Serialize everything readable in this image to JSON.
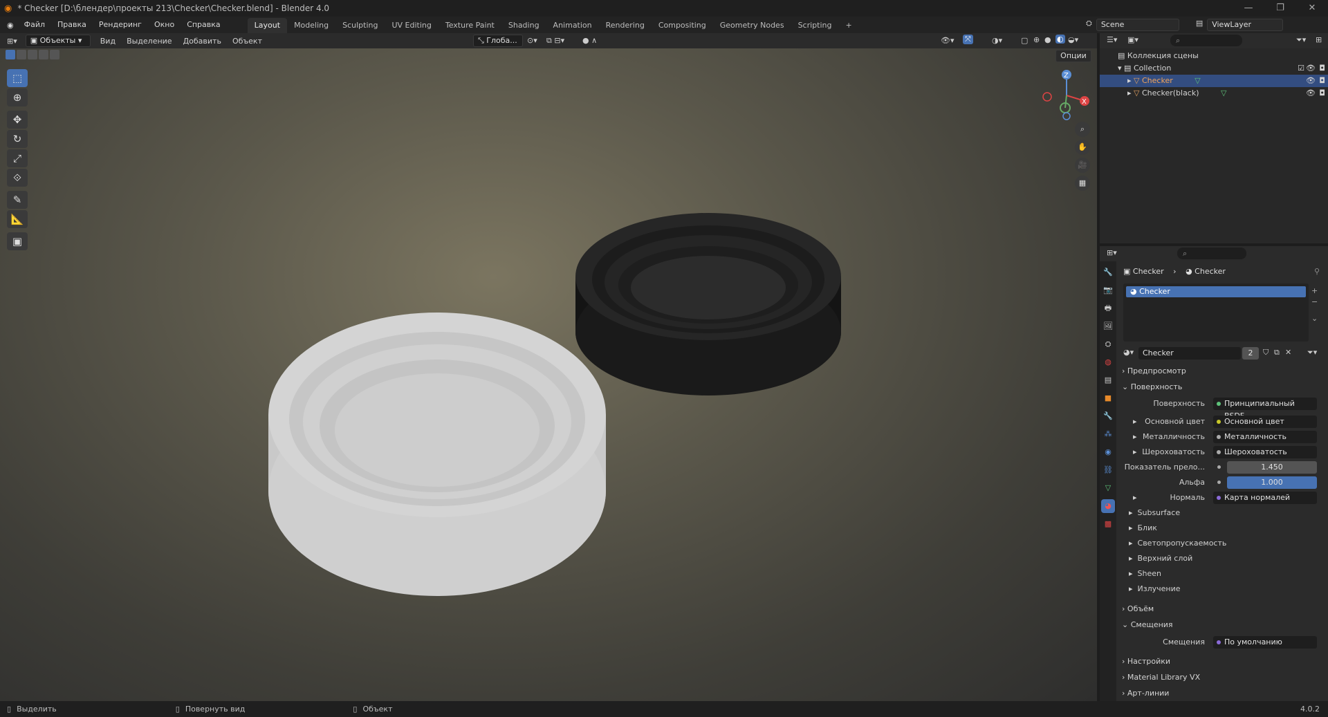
{
  "titlebar": {
    "title": "* Checker [D:\\блендер\\проекты 213\\Checker\\Checker.blend] - Blender 4.0"
  },
  "menu": [
    "Файл",
    "Правка",
    "Рендеринг",
    "Окно",
    "Справка"
  ],
  "workspaces": [
    "Layout",
    "Modeling",
    "Sculpting",
    "UV Editing",
    "Texture Paint",
    "Shading",
    "Animation",
    "Rendering",
    "Compositing",
    "Geometry Nodes",
    "Scripting"
  ],
  "scene": "Scene",
  "viewlayer": "ViewLayer",
  "viewport_header": {
    "mode": "Объекты",
    "menus": [
      "Вид",
      "Выделение",
      "Добавить",
      "Объект"
    ],
    "orientation": "Глоба...",
    "options": "Опции"
  },
  "gizmo": {
    "z": "Z",
    "x": "X"
  },
  "outliner": {
    "root": "Коллекция сцены",
    "collection": "Collection",
    "objects": [
      {
        "name": "Checker",
        "selected": true
      },
      {
        "name": "Checker(black)",
        "selected": false
      }
    ]
  },
  "properties": {
    "breadcrumb": {
      "object": "Checker",
      "material": "Checker"
    },
    "slot": "Checker",
    "material_name": "Checker",
    "users": "2",
    "sections": {
      "preview": "Предпросмотр",
      "surface": "Поверхность",
      "volume": "Объём",
      "displacement": "Смещения",
      "settings": "Настройки",
      "mlvx": "Material Library VX",
      "lineart": "Арт-линии"
    },
    "surface_rows": {
      "surface_label": "Поверхность",
      "surface_value": "Принципиальный BSDF",
      "base_label": "Основной цвет",
      "base_value": "Основной цвет",
      "metal_label": "Металличность",
      "metal_value": "Металличность",
      "rough_label": "Шероховатость",
      "rough_value": "Шероховатость",
      "ior_label": "Показатель прело...",
      "ior_value": "1.450",
      "alpha_label": "Альфа",
      "alpha_value": "1.000",
      "normal_label": "Нормаль",
      "normal_value": "Карта нормалей"
    },
    "subsections": [
      "Subsurface",
      "Блик",
      "Светопропускаемость",
      "Верхний слой",
      "Sheen",
      "Излучение"
    ],
    "disp_label": "Смещения",
    "disp_value": "По умолчанию"
  },
  "statusbar": {
    "select": "Выделить",
    "rotate": "Повернуть вид",
    "object": "Объект",
    "version": "4.0.2"
  },
  "colors": {
    "accent": "#4772b3",
    "selected_row": "#334d80",
    "bg": "#1d1d1d"
  }
}
